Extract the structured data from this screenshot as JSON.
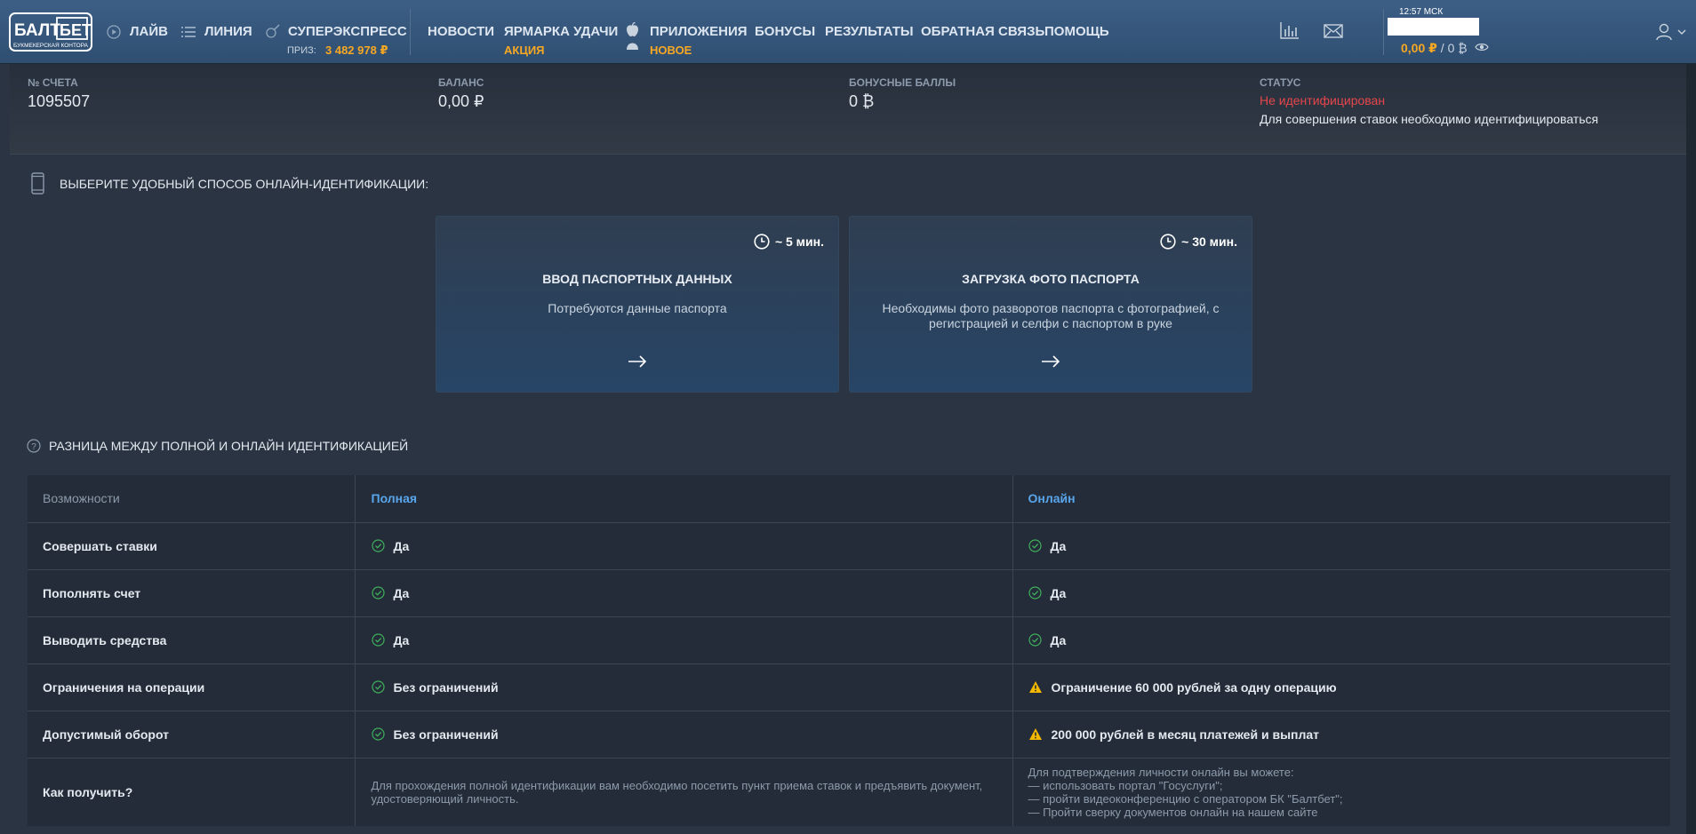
{
  "header": {
    "logo_text_top": "БАЛТ",
    "logo_text_box": "БЕТ",
    "logo_text_sub": "БУКМЕКЕРСКАЯ КОНТОРА",
    "nav": {
      "live": "ЛАЙВ",
      "line": "ЛИНИЯ",
      "superexpress": "СУПЕРЭКСПРЕСС",
      "prize_label": "ПРИЗ:",
      "prize_value": "3 482 978 ₽",
      "news": "НОВОСТИ",
      "fair": "ЯРМАРКА УДАЧИ",
      "fair_badge": "АКЦИЯ",
      "apps": "ПРИЛОЖЕНИЯ",
      "apps_badge": "НОВОЕ",
      "bonuses": "БОНУСЫ",
      "results": "РЕЗУЛЬТАТЫ",
      "feedback": "ОБРАТНАЯ СВЯЗЬ",
      "help": "ПОМОЩЬ"
    },
    "clock": "12:57 МСК",
    "balance_rub": "0,00 ₽",
    "balance_sep": " / ",
    "balance_bonus": "0 ₿",
    "icons": [
      "chart-icon",
      "mail-icon",
      "eye-icon",
      "user-icon",
      "chevron-down-icon"
    ]
  },
  "summary": {
    "account_label": "№ СЧЕТА",
    "account_value": "1095507",
    "balance_label": "БАЛАНС",
    "balance_value": "0,00 ₽",
    "bonus_label": "БОНУСНЫЕ БАЛЛЫ",
    "bonus_value": "0 ₿",
    "status_label": "СТАТУС",
    "status_value": "Не идентифицирован",
    "status_note": "Для совершения ставок необходимо идентифицироваться"
  },
  "identify": {
    "title": "ВЫБЕРИТЕ УДОБНЫЙ СПОСОБ ОНЛАЙН-ИДЕНТИФИКАЦИИ:",
    "cards": [
      {
        "time": "~ 5 мин.",
        "title": "ВВОД ПАСПОРТНЫХ ДАННЫХ",
        "desc": "Потребуются данные паспорта"
      },
      {
        "time": "~ 30 мин.",
        "title": "ЗАГРУЗКА ФОТО ПАСПОРТА",
        "desc": "Необходимы фото разворотов паспорта с фотографией, с регистрацией и селфи с паспортом в руке"
      }
    ]
  },
  "diff": {
    "title": "РАЗНИЦА МЕЖДУ ПОЛНОЙ И ОНЛАЙН ИДЕНТИФИКАЦИЕЙ",
    "columns": [
      "Возможности",
      "Полная",
      "Онлайн"
    ],
    "rows": [
      {
        "feature": "Совершать ставки",
        "full": "Да",
        "online": "Да"
      },
      {
        "feature": "Пополнять счет",
        "full": "Да",
        "online": "Да"
      },
      {
        "feature": "Выводить средства",
        "full": "Да",
        "online": "Да"
      },
      {
        "feature": "Ограничения на операции",
        "full": "Без ограничений",
        "online": "Ограничение 60 000 рублей за одну операцию"
      },
      {
        "feature": "Допустимый оборот",
        "full": "Без ограничений",
        "online": "200 000 рублей в месяц платежей и выплат"
      }
    ],
    "how": {
      "feature": "Как получить?",
      "full": "Для прохождения полной идентификации вам необходимо посетить пункт приема ставок и предъявить документ, удостоверяющий личность.",
      "online_lines": [
        "Для подтверждения личности онлайн вы можете:",
        "— использовать портал \"Госуслуги\";",
        "— пройти видеоконференцию с оператором БК \"Балтбет\";",
        "— Пройти сверку документов онлайн на нашем сайте"
      ]
    }
  },
  "colors": {
    "accent_orange": "#f7a823",
    "accent_blue": "#5aa6ec",
    "status_red": "#e6464b",
    "check_green": "#3fae5b",
    "warn_yellow": "#f5b800"
  }
}
